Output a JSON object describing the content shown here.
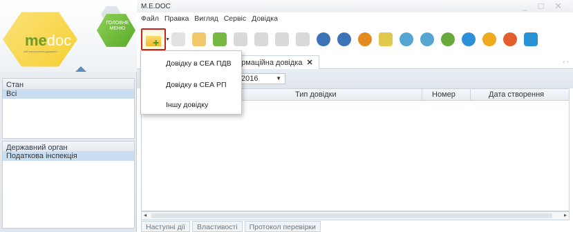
{
  "logo": {
    "me": "me",
    "doc": "doc",
    "subtitle": "мій електронний документ",
    "home_menu": "ГОЛОВНЕ МЕНЮ"
  },
  "sidebar": {
    "stan_header": "Стан",
    "stan_items": [
      {
        "label": "Всі"
      }
    ],
    "organ_header": "Державний орган",
    "organ_items": [
      {
        "label": "Податкова інспекція"
      }
    ]
  },
  "window": {
    "title": "M.E.DOC",
    "controls": "_ □ ✕"
  },
  "menu": [
    {
      "label": "Файл"
    },
    {
      "label": "Правка"
    },
    {
      "label": "Вигляд"
    },
    {
      "label": "Сервіс"
    },
    {
      "label": "Довідка"
    }
  ],
  "toolbar": {
    "new_icon": "folder-plus-icon",
    "icons": [
      "folder-icon",
      "folder-delete-icon",
      "green-doc-icon",
      "gray-doc-icon",
      "doc-add-icon",
      "doc-list-icon",
      "doc-arrow-icon",
      "gear-icon",
      "print-icon",
      "box-icon",
      "archive-icon",
      "disk-icon",
      "check-icon",
      "refresh-icon",
      "globe-icon",
      "help-icon",
      "chat-icon",
      "web-icon"
    ]
  },
  "tab": {
    "label": "ормаційна довідка",
    "close": "✕",
    "nav": "‹ ›"
  },
  "filter": {
    "year": "2016"
  },
  "grid": {
    "columns": [
      "Тип довідки",
      "Номер",
      "Дата створення"
    ]
  },
  "scroll": {
    "left": "◂",
    "right": "▸"
  },
  "bottom_tabs": [
    {
      "label": "Наступні дії"
    },
    {
      "label": "Властивості"
    },
    {
      "label": "Протокол перевірки"
    }
  ],
  "dropdown": {
    "items": [
      {
        "label": "Довідку в СЕА ПДВ"
      },
      {
        "label": "Довідку в СЕА РП"
      },
      {
        "label": "Іншу довідку"
      }
    ]
  },
  "colors": {
    "accent_green": "#6a9c2d",
    "highlight_red": "#c2241e",
    "selection_blue": "#c9def1"
  }
}
